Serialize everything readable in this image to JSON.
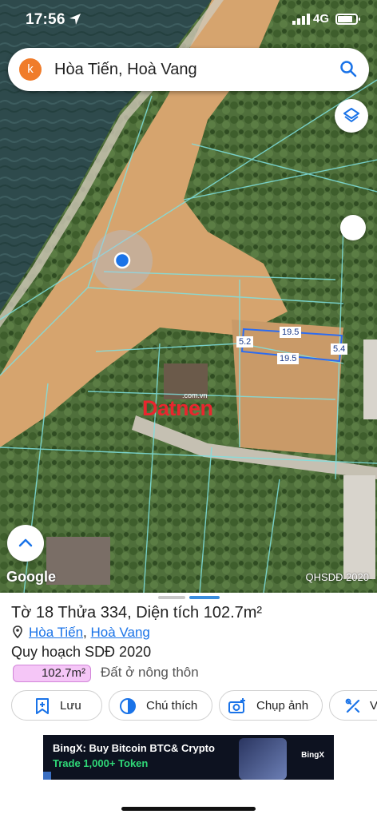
{
  "status": {
    "time": "17:56",
    "network": "4G"
  },
  "search": {
    "avatar": "k",
    "query": "Hòa Tiến, Hoà Vang"
  },
  "map": {
    "dimensions": [
      "19.5",
      "5.2",
      "19.5",
      "5.4"
    ],
    "watermark": "Datnen",
    "watermark_sub": ".com.vn",
    "google_label": "Google",
    "layer_label": "QHSDĐ 2020"
  },
  "sheet": {
    "parcel_title": "Tờ 18 Thửa 334, Diện tích 102.7m²",
    "address_commune": "Hòa Tiến",
    "address_separator": ",",
    "address_district": "Hoà Vang",
    "plan_title": "Quy hoạch SDĐ 2020",
    "area_badge": "102.7m²",
    "land_type": "Đất ở nông thôn",
    "actions": [
      {
        "label": "Lưu",
        "icon": "bookmark-plus-icon"
      },
      {
        "label": "Chú thích",
        "icon": "legend-icon"
      },
      {
        "label": "Chụp ảnh",
        "icon": "camera-add-icon"
      },
      {
        "label": "V",
        "icon": "tools-icon"
      }
    ]
  },
  "ad": {
    "line1": "BingX: Buy Bitcoin BTC& Crypto",
    "line2": "Trade 1,000+ Token",
    "brand": "BingX"
  },
  "colors": {
    "accent": "#1a73e8",
    "badge_fill": "#f5c6f7",
    "watermark": "#e8262e"
  }
}
